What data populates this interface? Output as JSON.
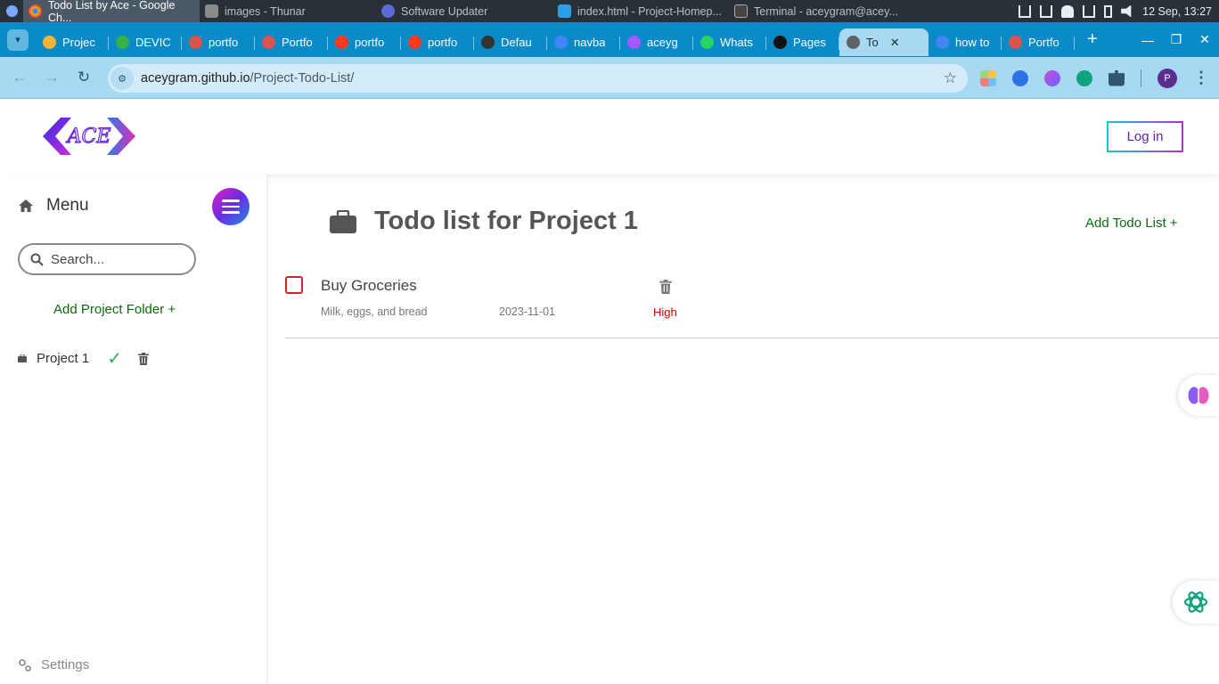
{
  "taskbar": {
    "tasks": [
      {
        "label": "Todo List by Ace - Google Ch...",
        "color": "#e8453c"
      },
      {
        "label": "images - Thunar",
        "color": "#8a8a8a"
      },
      {
        "label": "Software Updater",
        "color": "#5d6bd6"
      },
      {
        "label": "index.html - Project-Homep...",
        "color": "#2c9ee8"
      },
      {
        "label": "Terminal - aceygram@acey...",
        "color": "#444444"
      }
    ],
    "clock": "12 Sep, 13:27"
  },
  "browser": {
    "tabs": [
      {
        "label": "Projec",
        "color": "#f4b43a"
      },
      {
        "label": "DEVIC",
        "color": "#35b24a"
      },
      {
        "label": "portfo",
        "color": "#d9534f"
      },
      {
        "label": "Portfo",
        "color": "#d9534f"
      },
      {
        "label": "portfo",
        "color": "#ff3b1f"
      },
      {
        "label": "portfo",
        "color": "#ff3b1f"
      },
      {
        "label": "Defau",
        "color": "#333333"
      },
      {
        "label": "navba",
        "color": "#4285f4"
      },
      {
        "label": "aceyg",
        "color": "#a259ff"
      },
      {
        "label": "Whats",
        "color": "#25d366"
      },
      {
        "label": "Pages",
        "color": "#111111"
      },
      {
        "label": "To",
        "color": "#5f6368"
      },
      {
        "label": "how to",
        "color": "#4285f4"
      },
      {
        "label": "Portfo",
        "color": "#d9534f"
      }
    ],
    "active_tab_index": 11,
    "url_host": "aceygram.github.io",
    "url_path": "/Project-Todo-List/",
    "profile_initial": "P"
  },
  "header": {
    "logo_text": "ACE",
    "login_label": "Log in"
  },
  "sidebar": {
    "menu_title": "Menu",
    "search_placeholder": "Search...",
    "add_folder_label": "Add Project Folder +",
    "projects": [
      {
        "name": "Project 1",
        "check": "✓"
      }
    ],
    "settings_label": "Settings"
  },
  "main": {
    "title": "Todo list for Project 1",
    "add_todo_label": "Add Todo List +",
    "todos": [
      {
        "title": "Buy Groceries",
        "description": "Milk, eggs, and bread",
        "due_date": "2023-11-01",
        "priority": "High",
        "priority_color": "#d00000",
        "done": false
      }
    ]
  },
  "colors": {
    "accent_green": "#0b6b0b",
    "chrome_blue": "#0b8ac8"
  }
}
